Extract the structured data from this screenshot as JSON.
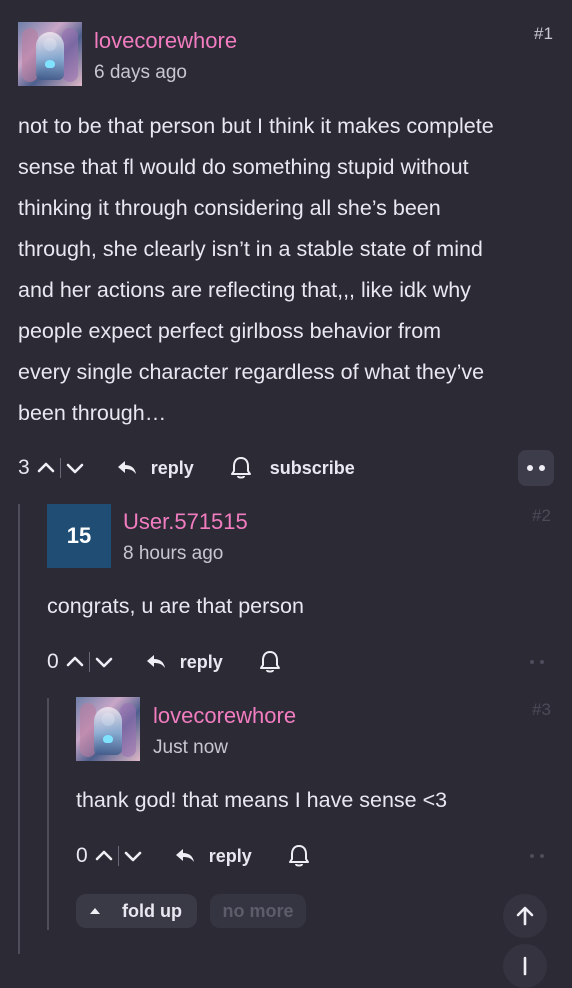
{
  "comments": [
    {
      "number": "#1",
      "username": "lovecorewhore",
      "time": "6 days ago",
      "avatar_icon": "anime-avatar-icon",
      "lines": [
        "not to be that person but I think it makes complete",
        "sense that fl would do something stupid without",
        "thinking it through considering all she’s been",
        "through, she clearly isn’t in a stable state of mind",
        "and her actions are reflecting that,,, like idk why",
        "people expect perfect girlboss behavior from",
        "every single character regardless of what they’ve",
        "been through…"
      ],
      "votes": "3",
      "reply_label": "reply",
      "subscribe_label": "subscribe"
    },
    {
      "number": "#2",
      "username": "User.571515",
      "time": "8 hours ago",
      "avatar_text": "15",
      "text": "congrats, u are that person",
      "votes": "0",
      "reply_label": "reply"
    },
    {
      "number": "#3",
      "username": "lovecorewhore",
      "time": "Just now",
      "avatar_icon": "anime-avatar-icon",
      "text": "thank god! that means I have sense <3",
      "votes": "0",
      "reply_label": "reply"
    }
  ],
  "footer": {
    "fold_label": "fold up",
    "no_more_label": "no more"
  },
  "colors": {
    "background": "#2c2b35",
    "username": "#f17cc0",
    "text": "#e9e7ef",
    "secondary": "#c8c6cf"
  }
}
